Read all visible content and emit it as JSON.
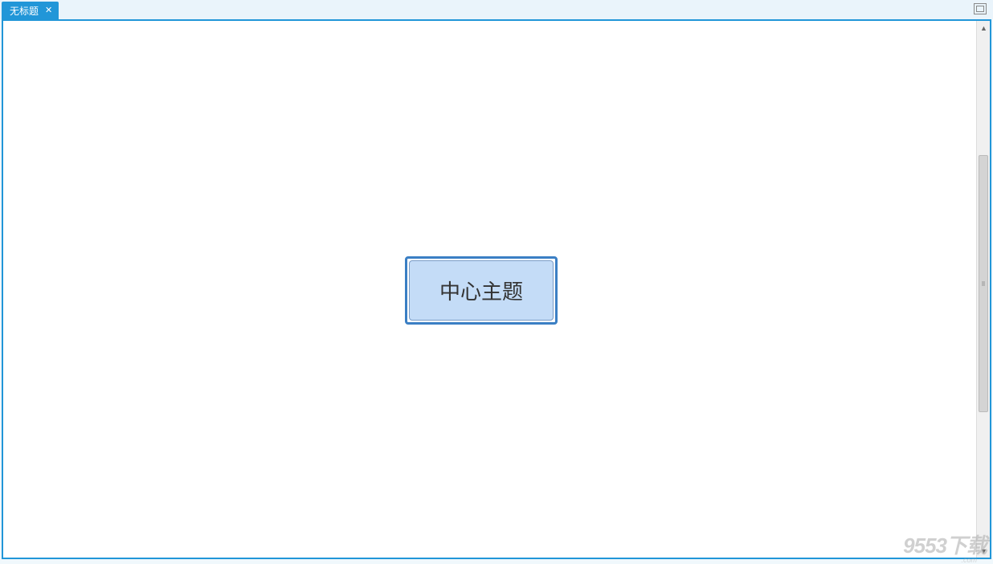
{
  "tab": {
    "title": "无标题"
  },
  "canvas": {
    "central_topic": "中心主题"
  },
  "watermark": {
    "text": "9553下载",
    "sub": ".com"
  }
}
